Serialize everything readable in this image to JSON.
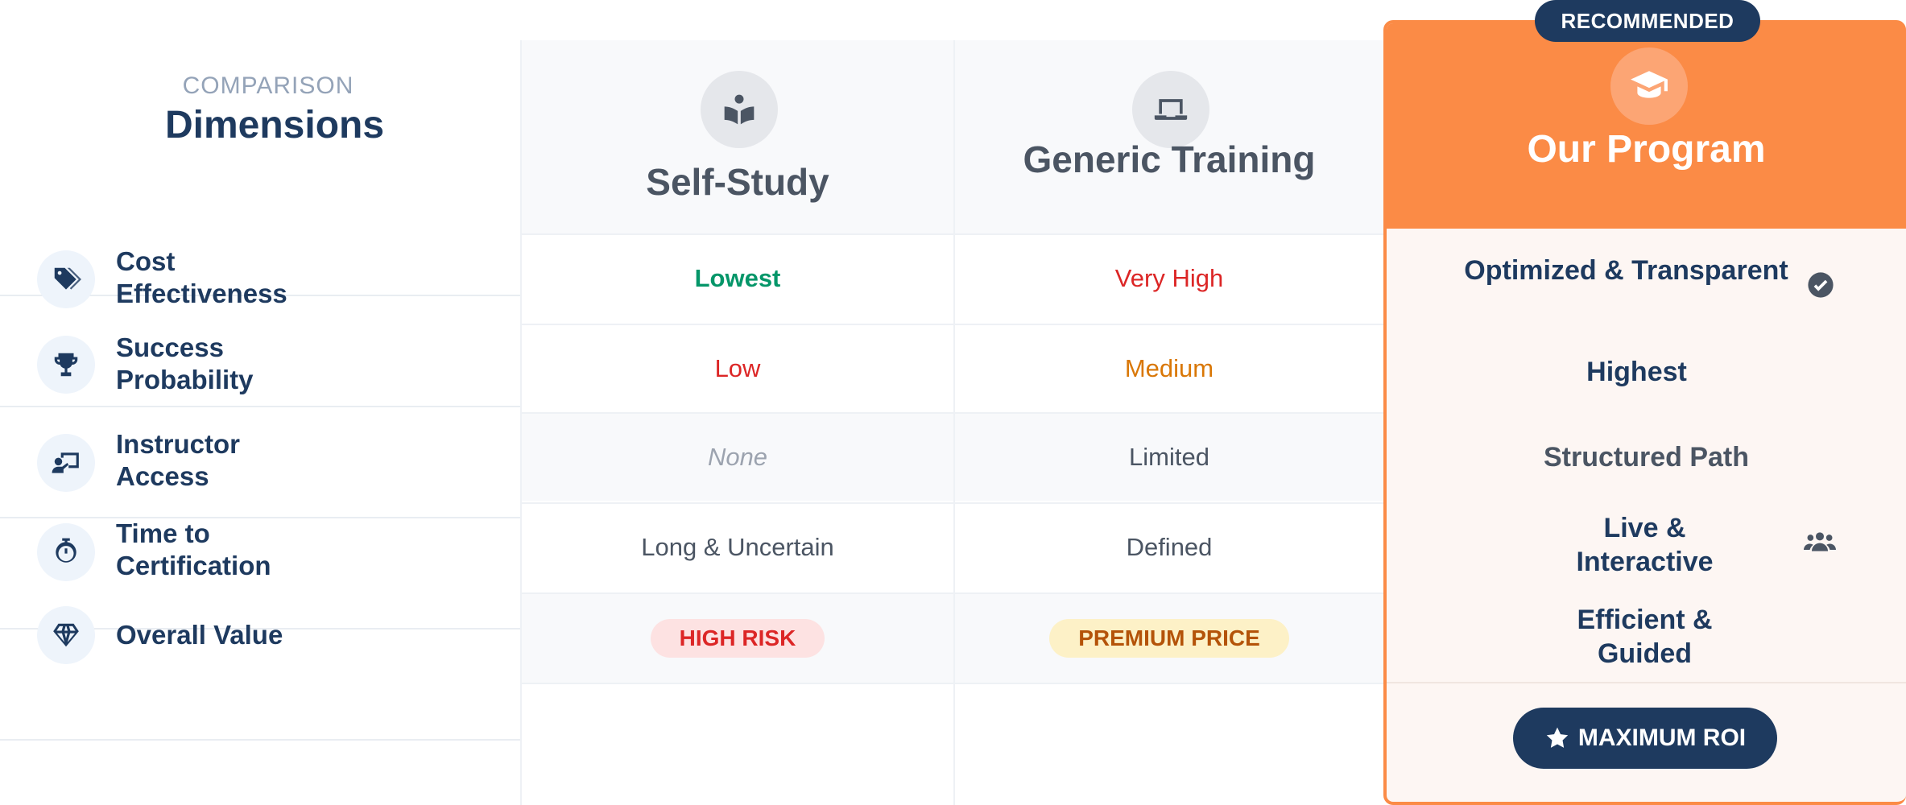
{
  "dimensions": {
    "kicker": "COMPARISON",
    "title": "Dimensions",
    "rows": [
      {
        "label": "Cost Effectiveness",
        "icon": "tags-icon"
      },
      {
        "label": "Success Probability",
        "icon": "trophy-icon"
      },
      {
        "label": "Instructor Access",
        "icon": "chalkboard-teacher-icon"
      },
      {
        "label": "Time to Certification",
        "icon": "stopwatch-icon"
      },
      {
        "label": "Overall Value",
        "icon": "gem-icon"
      }
    ]
  },
  "columns": [
    {
      "title": "Self-Study",
      "icon": "book-reader-icon",
      "cells": [
        "Lowest",
        "Low",
        "None",
        "Long & Uncertain"
      ],
      "badge": "HIGH RISK"
    },
    {
      "title": "Generic Training",
      "icon": "laptop-icon",
      "cells": [
        "Very High",
        "Medium",
        "Limited",
        "Defined"
      ],
      "badge": "PREMIUM PRICE"
    }
  ],
  "featured": {
    "badge": "RECOMMENDED",
    "title": "Our Program",
    "icon": "graduation-cap-icon",
    "cells": [
      "Optimized & Transparent",
      "Highest",
      "Structured Path",
      "Live & Interactive",
      "Efficient & Guided"
    ],
    "button": "MAXIMUM ROI"
  },
  "colors": {
    "navy": "#1e3a5f",
    "accent": "#fb8b46",
    "success": "#059669",
    "danger": "#dc2626",
    "warning": "#d97706"
  }
}
